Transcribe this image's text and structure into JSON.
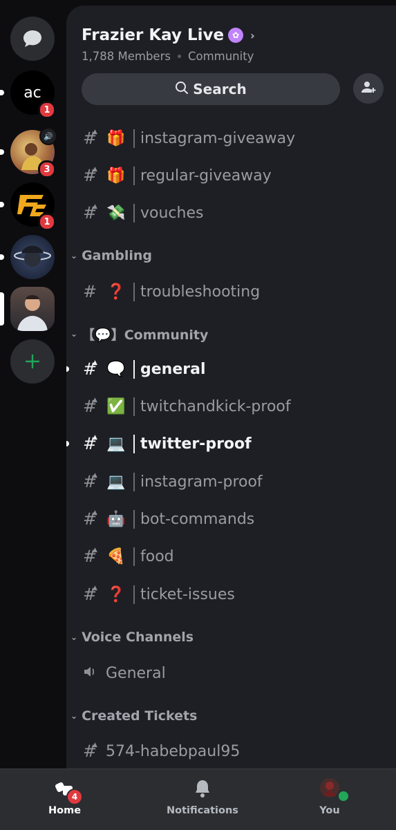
{
  "server": {
    "name": "Frazier Kay Live",
    "member_count": "1,788 Members",
    "type": "Community"
  },
  "search": {
    "label": "Search"
  },
  "rail": {
    "servers": [
      {
        "name": "AC",
        "badge": "1"
      },
      {
        "name": "server-2",
        "badge": "3"
      },
      {
        "name": "FC",
        "badge": "1"
      },
      {
        "name": "server-4",
        "badge": ""
      },
      {
        "name": "server-5",
        "badge": ""
      }
    ]
  },
  "channels_top": [
    {
      "emoji": "🎁",
      "name": "instagram-giveaway"
    },
    {
      "emoji": "🎁",
      "name": "regular-giveaway"
    },
    {
      "emoji": "💸",
      "name": "vouches"
    }
  ],
  "categories": {
    "gambling": "Gambling",
    "community": "【💬】Community",
    "voice": "Voice Channels",
    "tickets": "Created Tickets"
  },
  "channels_gambling": [
    {
      "emoji": "❓",
      "name": "troubleshooting"
    }
  ],
  "channels_community": [
    {
      "emoji": "🗨️",
      "name": "general",
      "unread": true
    },
    {
      "emoji": "✅",
      "name": "twitchandkick-proof"
    },
    {
      "emoji": "💻",
      "name": "twitter-proof",
      "unread": true
    },
    {
      "emoji": "💻",
      "name": "instagram-proof"
    },
    {
      "emoji": "🤖",
      "name": "bot-commands"
    },
    {
      "emoji": "🍕",
      "name": "food"
    },
    {
      "emoji": "❓",
      "name": "ticket-issues"
    }
  ],
  "voice": {
    "name": "General"
  },
  "ticket": {
    "name": "574-habebpaul95"
  },
  "nav": {
    "home": {
      "label": "Home",
      "badge": "4"
    },
    "notifications": {
      "label": "Notifications"
    },
    "you": {
      "label": "You"
    }
  },
  "colors": {
    "accent_green": "#23a55a",
    "badge_red": "#e03a3f",
    "panel": "#1e1f24"
  }
}
